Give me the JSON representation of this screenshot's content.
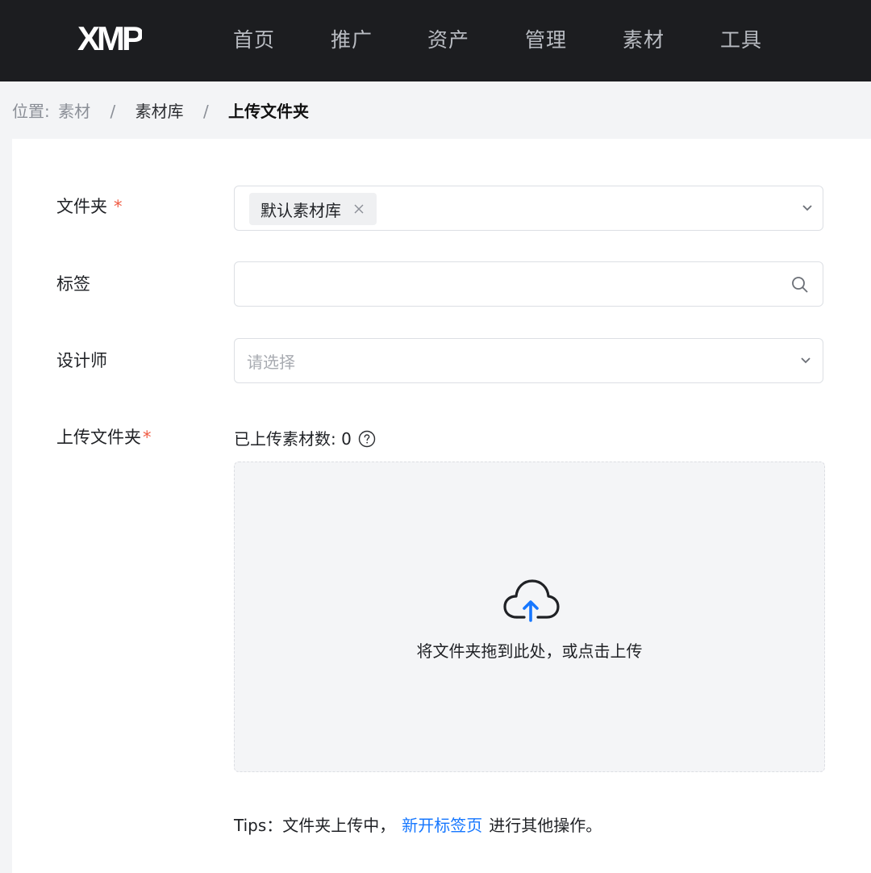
{
  "app": {
    "logo_text": "XMP"
  },
  "nav": {
    "items": [
      {
        "label": "首页"
      },
      {
        "label": "推广"
      },
      {
        "label": "资产"
      },
      {
        "label": "管理"
      },
      {
        "label": "素材"
      },
      {
        "label": "工具"
      }
    ]
  },
  "breadcrumb": {
    "prefix": "位置:",
    "items": [
      "素材",
      "素材库",
      "上传文件夹"
    ],
    "separator": "/"
  },
  "form": {
    "folder": {
      "label": "文件夹",
      "required_mark": "*",
      "selected_tag": "默认素材库",
      "icon": "chevron-down-icon"
    },
    "tags": {
      "label": "标签",
      "value": "",
      "icon": "search-icon"
    },
    "designer": {
      "label": "设计师",
      "placeholder": "请选择",
      "icon": "chevron-down-icon"
    },
    "upload": {
      "label": "上传文件夹",
      "required_mark": "*",
      "count_text": "已上传素材数: 0",
      "help_icon": "question-circle-icon",
      "drop_text": "将文件夹拖到此处，或点击上传",
      "upload_icon": "cloud-upload-icon"
    }
  },
  "tips": {
    "prefix": "Tips：文件夹上传中，",
    "link": "新开标签页",
    "suffix": "进行其他操作。"
  },
  "colors": {
    "topbar": "#1c1d20",
    "accent": "#1677ff",
    "required": "#f05b43"
  }
}
